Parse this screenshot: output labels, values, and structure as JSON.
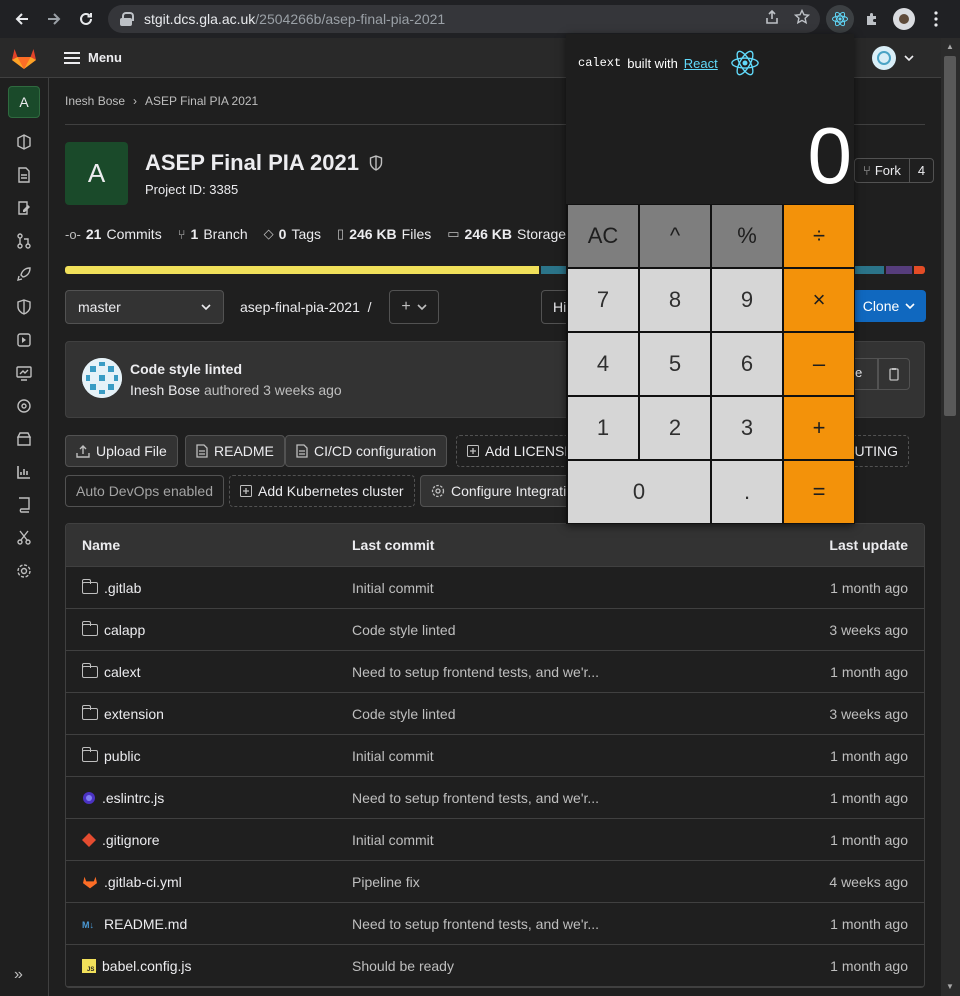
{
  "browser": {
    "url_host": "stgit.dcs.gla.ac.uk",
    "url_path": "/2504266b/asep-final-pia-2021"
  },
  "gitlab": {
    "menu_label": "Menu",
    "project_avatar_letter": "A",
    "breadcrumb": [
      "Inesh Bose",
      "ASEP Final PIA 2021"
    ],
    "project_title": "ASEP Final PIA 2021",
    "project_id": "Project ID: 3385",
    "stats": [
      {
        "num": "21",
        "label": "Commits"
      },
      {
        "num": "1",
        "label": "Branch"
      },
      {
        "num": "0",
        "label": "Tags"
      },
      {
        "num": "246 KB",
        "label": "Files"
      },
      {
        "num": "246 KB",
        "label": "Storage"
      }
    ],
    "fork_label": "Fork",
    "fork_count": "4",
    "branch": "master",
    "path_label": "asep-final-pia-2021",
    "path_sep": "/",
    "history_label": "Hi",
    "clone_label": "Clone",
    "commit": {
      "title": "Code style linted",
      "author": "Inesh Bose",
      "meta": "authored 3 weeks ago",
      "sha": "7e"
    },
    "quick_actions": {
      "upload": "Upload File",
      "readme": "README",
      "cicd": "CI/CD configuration",
      "license": "Add LICENSE",
      "contributing": "BUTING",
      "autodevops": "Auto DevOps enabled",
      "kubernetes": "Add Kubernetes cluster",
      "integrations": "Configure Integrati"
    },
    "table": {
      "headers": {
        "name": "Name",
        "commit": "Last commit",
        "date": "Last update"
      },
      "rows": [
        {
          "name": ".gitlab",
          "commit": "Initial commit",
          "date": "1 month ago",
          "icon": "folder"
        },
        {
          "name": "calapp",
          "commit": "Code style linted",
          "date": "3 weeks ago",
          "icon": "folder"
        },
        {
          "name": "calext",
          "commit": "Need to setup frontend tests, and we'r...",
          "date": "1 month ago",
          "icon": "folder"
        },
        {
          "name": "extension",
          "commit": "Code style linted",
          "date": "3 weeks ago",
          "icon": "folder"
        },
        {
          "name": "public",
          "commit": "Initial commit",
          "date": "1 month ago",
          "icon": "folder"
        },
        {
          "name": ".eslintrc.js",
          "commit": "Need to setup frontend tests, and we'r...",
          "date": "1 month ago",
          "icon": "eslint"
        },
        {
          "name": ".gitignore",
          "commit": "Initial commit",
          "date": "1 month ago",
          "icon": "git"
        },
        {
          "name": ".gitlab-ci.yml",
          "commit": "Pipeline fix",
          "date": "4 weeks ago",
          "icon": "gitlab"
        },
        {
          "name": "README.md",
          "commit": "Need to setup frontend tests, and we'r...",
          "date": "1 month ago",
          "icon": "markdown"
        },
        {
          "name": "babel.config.js",
          "commit": "Should be ready",
          "date": "1 month ago",
          "icon": "js"
        }
      ]
    },
    "language_bar": [
      {
        "color": "#f1e05a",
        "pct": 55.5
      },
      {
        "color": "#2b7489",
        "pct": 40.2
      },
      {
        "color": "#563d7c",
        "pct": 3.0
      },
      {
        "color": "#e34c26",
        "pct": 1.3
      }
    ]
  },
  "calculator": {
    "app_name": "calext",
    "built_with": "built with",
    "framework_link": "React",
    "display_value": "0",
    "keys": [
      {
        "label": "AC",
        "kind": "fn"
      },
      {
        "label": "^",
        "kind": "fn"
      },
      {
        "label": "%",
        "kind": "fn"
      },
      {
        "label": "÷",
        "kind": "op"
      },
      {
        "label": "7",
        "kind": "num"
      },
      {
        "label": "8",
        "kind": "num"
      },
      {
        "label": "9",
        "kind": "num"
      },
      {
        "label": "×",
        "kind": "op"
      },
      {
        "label": "4",
        "kind": "num"
      },
      {
        "label": "5",
        "kind": "num"
      },
      {
        "label": "6",
        "kind": "num"
      },
      {
        "label": "–",
        "kind": "op"
      },
      {
        "label": "1",
        "kind": "num"
      },
      {
        "label": "2",
        "kind": "num"
      },
      {
        "label": "3",
        "kind": "num"
      },
      {
        "label": "+",
        "kind": "op"
      },
      {
        "label": "0",
        "kind": "zero"
      },
      {
        "label": ".",
        "kind": "num"
      },
      {
        "label": "=",
        "kind": "op"
      }
    ],
    "colors": {
      "operator": "#f3920a",
      "function": "#7e7e7e",
      "number": "#d6d6d6",
      "react": "#61dafb"
    }
  }
}
